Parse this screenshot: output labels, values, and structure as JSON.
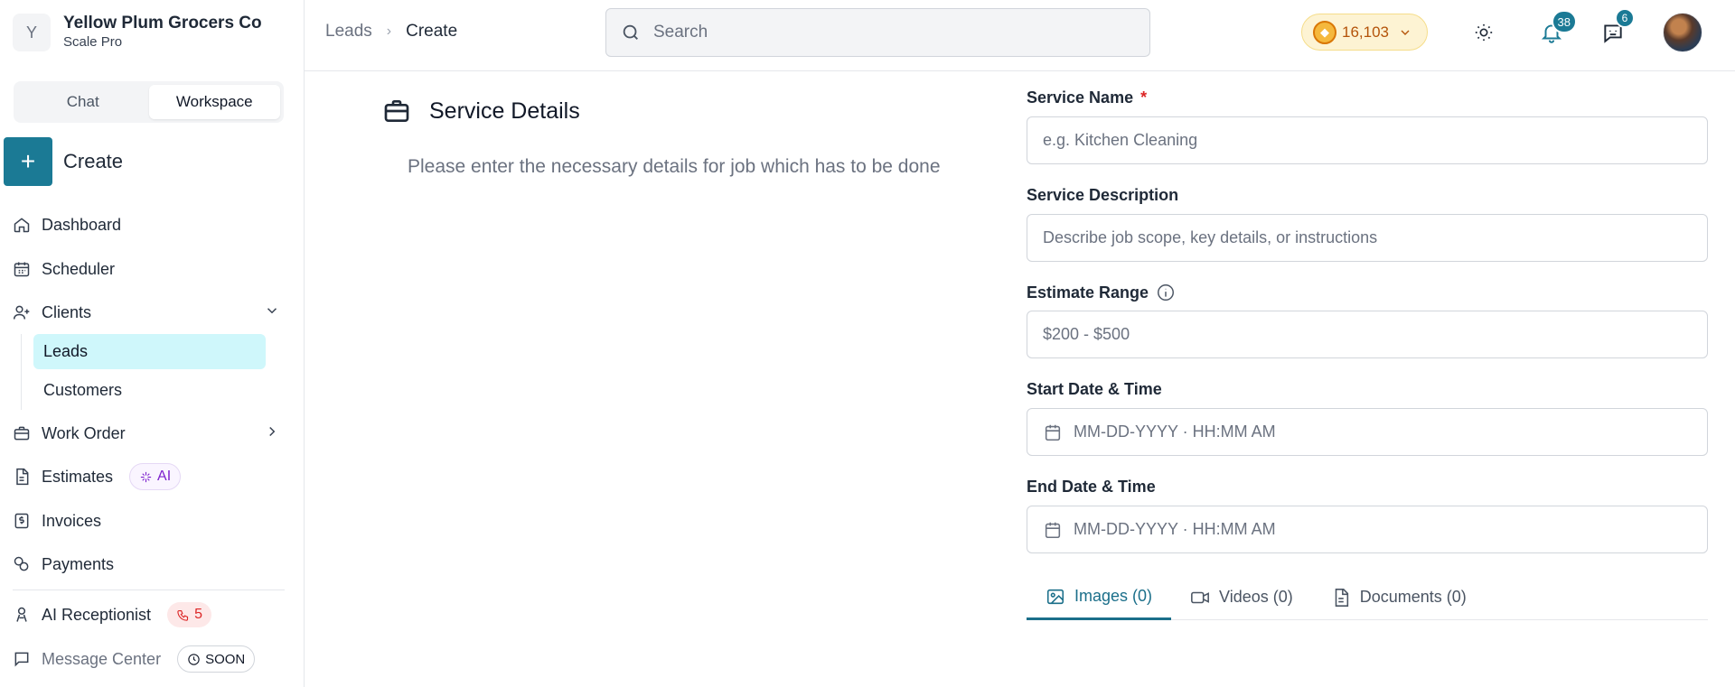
{
  "org": {
    "initial": "Y",
    "name": "Yellow Plum Grocers Co",
    "plan": "Scale Pro"
  },
  "mode_toggle": {
    "chat": "Chat",
    "workspace": "Workspace",
    "selected": "Workspace"
  },
  "create": {
    "label": "Create"
  },
  "nav": {
    "dashboard": "Dashboard",
    "scheduler": "Scheduler",
    "clients": "Clients",
    "clients_children": {
      "leads": "Leads",
      "customers": "Customers"
    },
    "work_order": "Work Order",
    "estimates": "Estimates",
    "estimates_badge": "AI",
    "invoices": "Invoices",
    "payments": "Payments",
    "ai_receptionist": "AI Receptionist",
    "ai_receptionist_count": "5",
    "message_center": "Message Center",
    "message_center_badge": "SOON"
  },
  "breadcrumb": {
    "parent": "Leads",
    "current": "Create"
  },
  "search": {
    "placeholder": "Search"
  },
  "credits": {
    "value": "16,103"
  },
  "notifications": {
    "count": "38"
  },
  "messages": {
    "count": "6"
  },
  "section": {
    "title": "Service Details",
    "description": "Please enter the necessary details for job which has to be done"
  },
  "form": {
    "service_name": {
      "label": "Service Name",
      "required_mark": "*",
      "placeholder": "e.g. Kitchen Cleaning"
    },
    "service_description": {
      "label": "Service Description",
      "placeholder": "Describe job scope, key details, or instructions"
    },
    "estimate_range": {
      "label": "Estimate Range",
      "placeholder": "$200 - $500"
    },
    "start": {
      "label": "Start Date & Time",
      "placeholder": "MM-DD-YYYY · HH:MM AM"
    },
    "end": {
      "label": "End Date & Time",
      "placeholder": "MM-DD-YYYY · HH:MM AM"
    }
  },
  "media_tabs": {
    "images": "Images (0)",
    "videos": "Videos (0)",
    "documents": "Documents (0)",
    "selected": "Images (0)"
  },
  "colors": {
    "accent": "#1b7a95",
    "active_nav_bg": "#cff7fb",
    "credits_bg": "#fdf3d3"
  }
}
